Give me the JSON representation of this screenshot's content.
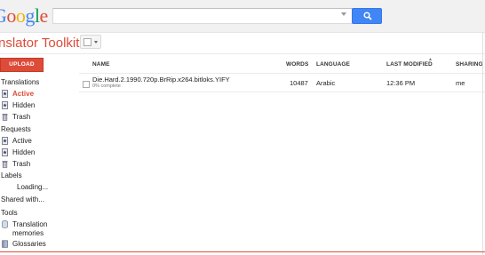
{
  "header": {
    "logo_letters": [
      "G",
      "o",
      "o",
      "g",
      "l",
      "e"
    ],
    "logo_colors": [
      "#4285f4",
      "#dd4b39",
      "#f4b400",
      "#4285f4",
      "#0f9d58",
      "#dd4b39"
    ],
    "search_value": "",
    "search_button_icon": "magnifier-icon",
    "search_button_color": "#4285f4"
  },
  "toolbar": {
    "app_title": "nslator Toolkit",
    "select_icon": "checkbox-dropdown-icon",
    "upload_label": "UPLOAD",
    "accent_color": "#dd4b39"
  },
  "sidebar": {
    "translations_header": "Translations",
    "translations": [
      {
        "label": "Active",
        "icon": "document-star-icon",
        "active": true
      },
      {
        "label": "Hidden",
        "icon": "document-star-icon"
      },
      {
        "label": "Trash",
        "icon": "trash-icon"
      }
    ],
    "requests_header": "Requests",
    "requests": [
      {
        "label": "Active",
        "icon": "document-star-icon"
      },
      {
        "label": "Hidden",
        "icon": "document-star-icon"
      },
      {
        "label": "Trash",
        "icon": "trash-icon"
      }
    ],
    "labels_header": "Labels",
    "labels_loading": "Loading...",
    "shared_with": "Shared with...",
    "tools_header": "Tools",
    "tools": [
      {
        "label_line1": "Translation",
        "label_line2": "memories",
        "icon": "database-icon"
      },
      {
        "label_line1": "Glossaries",
        "label_line2": "",
        "icon": "book-icon"
      }
    ]
  },
  "table": {
    "columns": {
      "name": "NAME",
      "words": "WORDS",
      "language": "LANGUAGE",
      "last_modified": "LAST MODIFIED",
      "sharing": "SHARING"
    },
    "sort_indicator": "▲",
    "rows": [
      {
        "name": "Die.Hard.2.1990.720p.BrRip.x264.bitloks.YIFY",
        "progress": "0% complete",
        "words": "10487",
        "language": "Arabic",
        "last_modified": "12:36 PM",
        "sharing": "me"
      }
    ]
  }
}
